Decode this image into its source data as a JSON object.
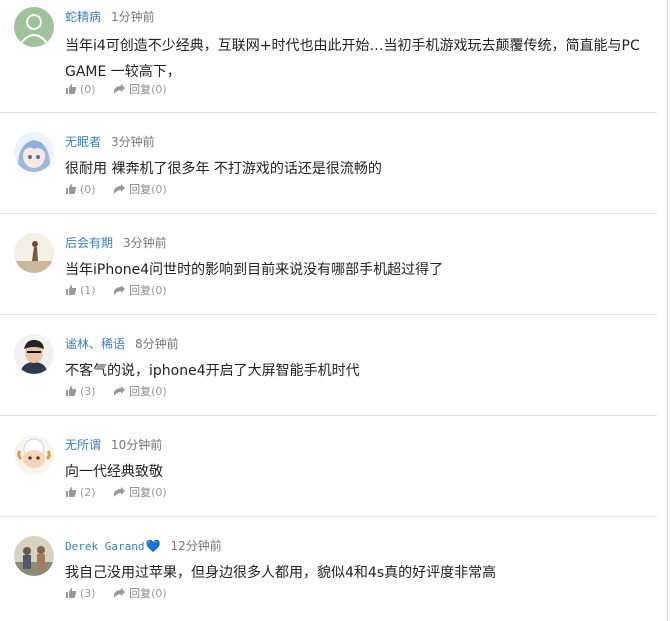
{
  "comments": [
    {
      "user": "蛇精病",
      "time": "1分钟前",
      "text": "当年i4可创造不少经典，互联网+时代也由此开始…当初手机游戏玩去颠覆传统，简直能与PC GAME 一较高下，",
      "likes": "(0)",
      "reply_label": "回复",
      "replies": "(0)"
    },
    {
      "user": "无眠者",
      "time": "3分钟前",
      "text": "很耐用 裸奔机了很多年 不打游戏的话还是很流畅的",
      "likes": "(0)",
      "reply_label": "回复",
      "replies": "(0)"
    },
    {
      "user": "后会有期",
      "time": "3分钟前",
      "text": "当年iPhone4问世时的影响到目前来说没有哪部手机超过得了",
      "likes": "(1)",
      "reply_label": "回复",
      "replies": "(0)"
    },
    {
      "user": "谧林、稀语",
      "time": "8分钟前",
      "text": "不客气的说，iphone4开启了大屏智能手机时代",
      "likes": "(3)",
      "reply_label": "回复",
      "replies": "(0)"
    },
    {
      "user": "无所谓",
      "time": "10分钟前",
      "text": "向一代经典致敬",
      "likes": "(2)",
      "reply_label": "回复",
      "replies": "(0)"
    },
    {
      "user": "Derek Garand",
      "user_badge": "heart-icon",
      "time": "12分钟前",
      "text": "我自己没用过苹果，但身边很多人都用，貌似4和4s真的好评度非常高",
      "likes": "(3)",
      "reply_label": "回复",
      "replies": "(0)"
    }
  ],
  "colors": {
    "username": "#3a7fc0",
    "heart": "#2d8ae3",
    "divider": "#e2e2e2"
  }
}
